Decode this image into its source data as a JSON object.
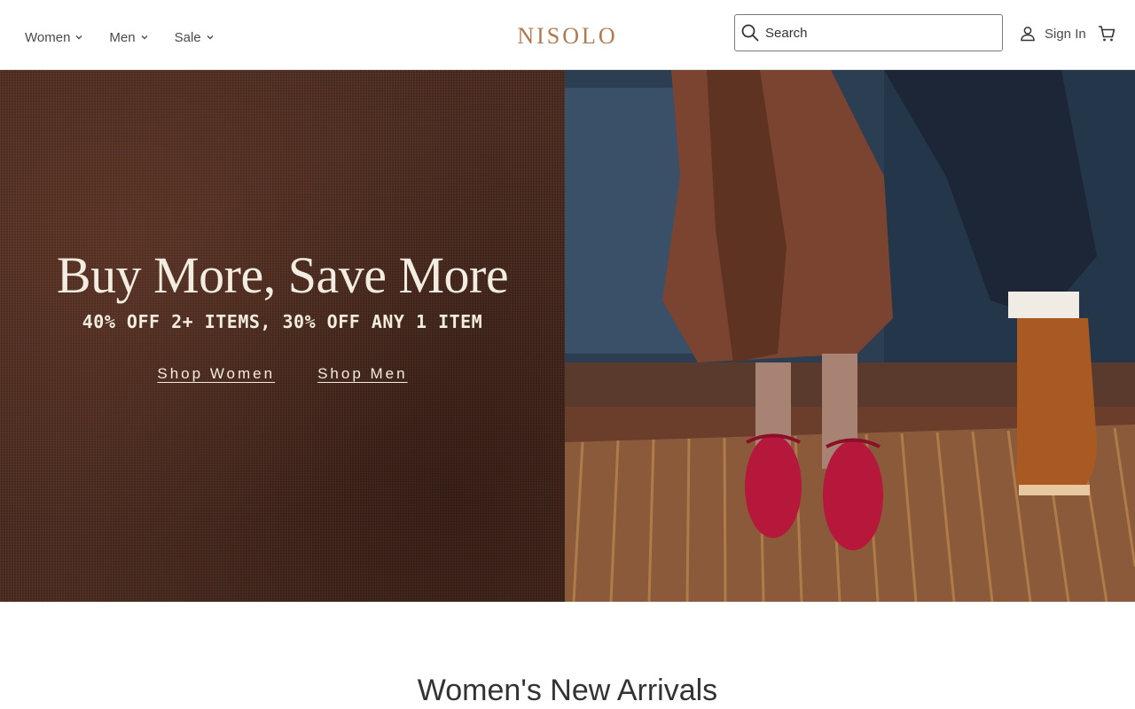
{
  "header": {
    "nav": [
      {
        "label": "Women"
      },
      {
        "label": "Men"
      },
      {
        "label": "Sale"
      }
    ],
    "logo": "NISOLO",
    "search": {
      "placeholder": "Search",
      "value": ""
    },
    "sign_in": "Sign In"
  },
  "hero": {
    "title": "Buy More, Save More",
    "subtitle": "40% OFF 2+ ITEMS, 30% OFF ANY 1 ITEM",
    "links": [
      {
        "label": "Shop Women"
      },
      {
        "label": "Shop Men"
      }
    ]
  },
  "section": {
    "title": "Women's New Arrivals"
  },
  "colors": {
    "brand": "#b07a4f",
    "hero_bg": "#4a2a1f",
    "hero_text": "#f3ece0",
    "text": "#333333"
  },
  "icons": [
    "chevron-down-icon",
    "search-icon",
    "user-icon",
    "cart-icon"
  ]
}
